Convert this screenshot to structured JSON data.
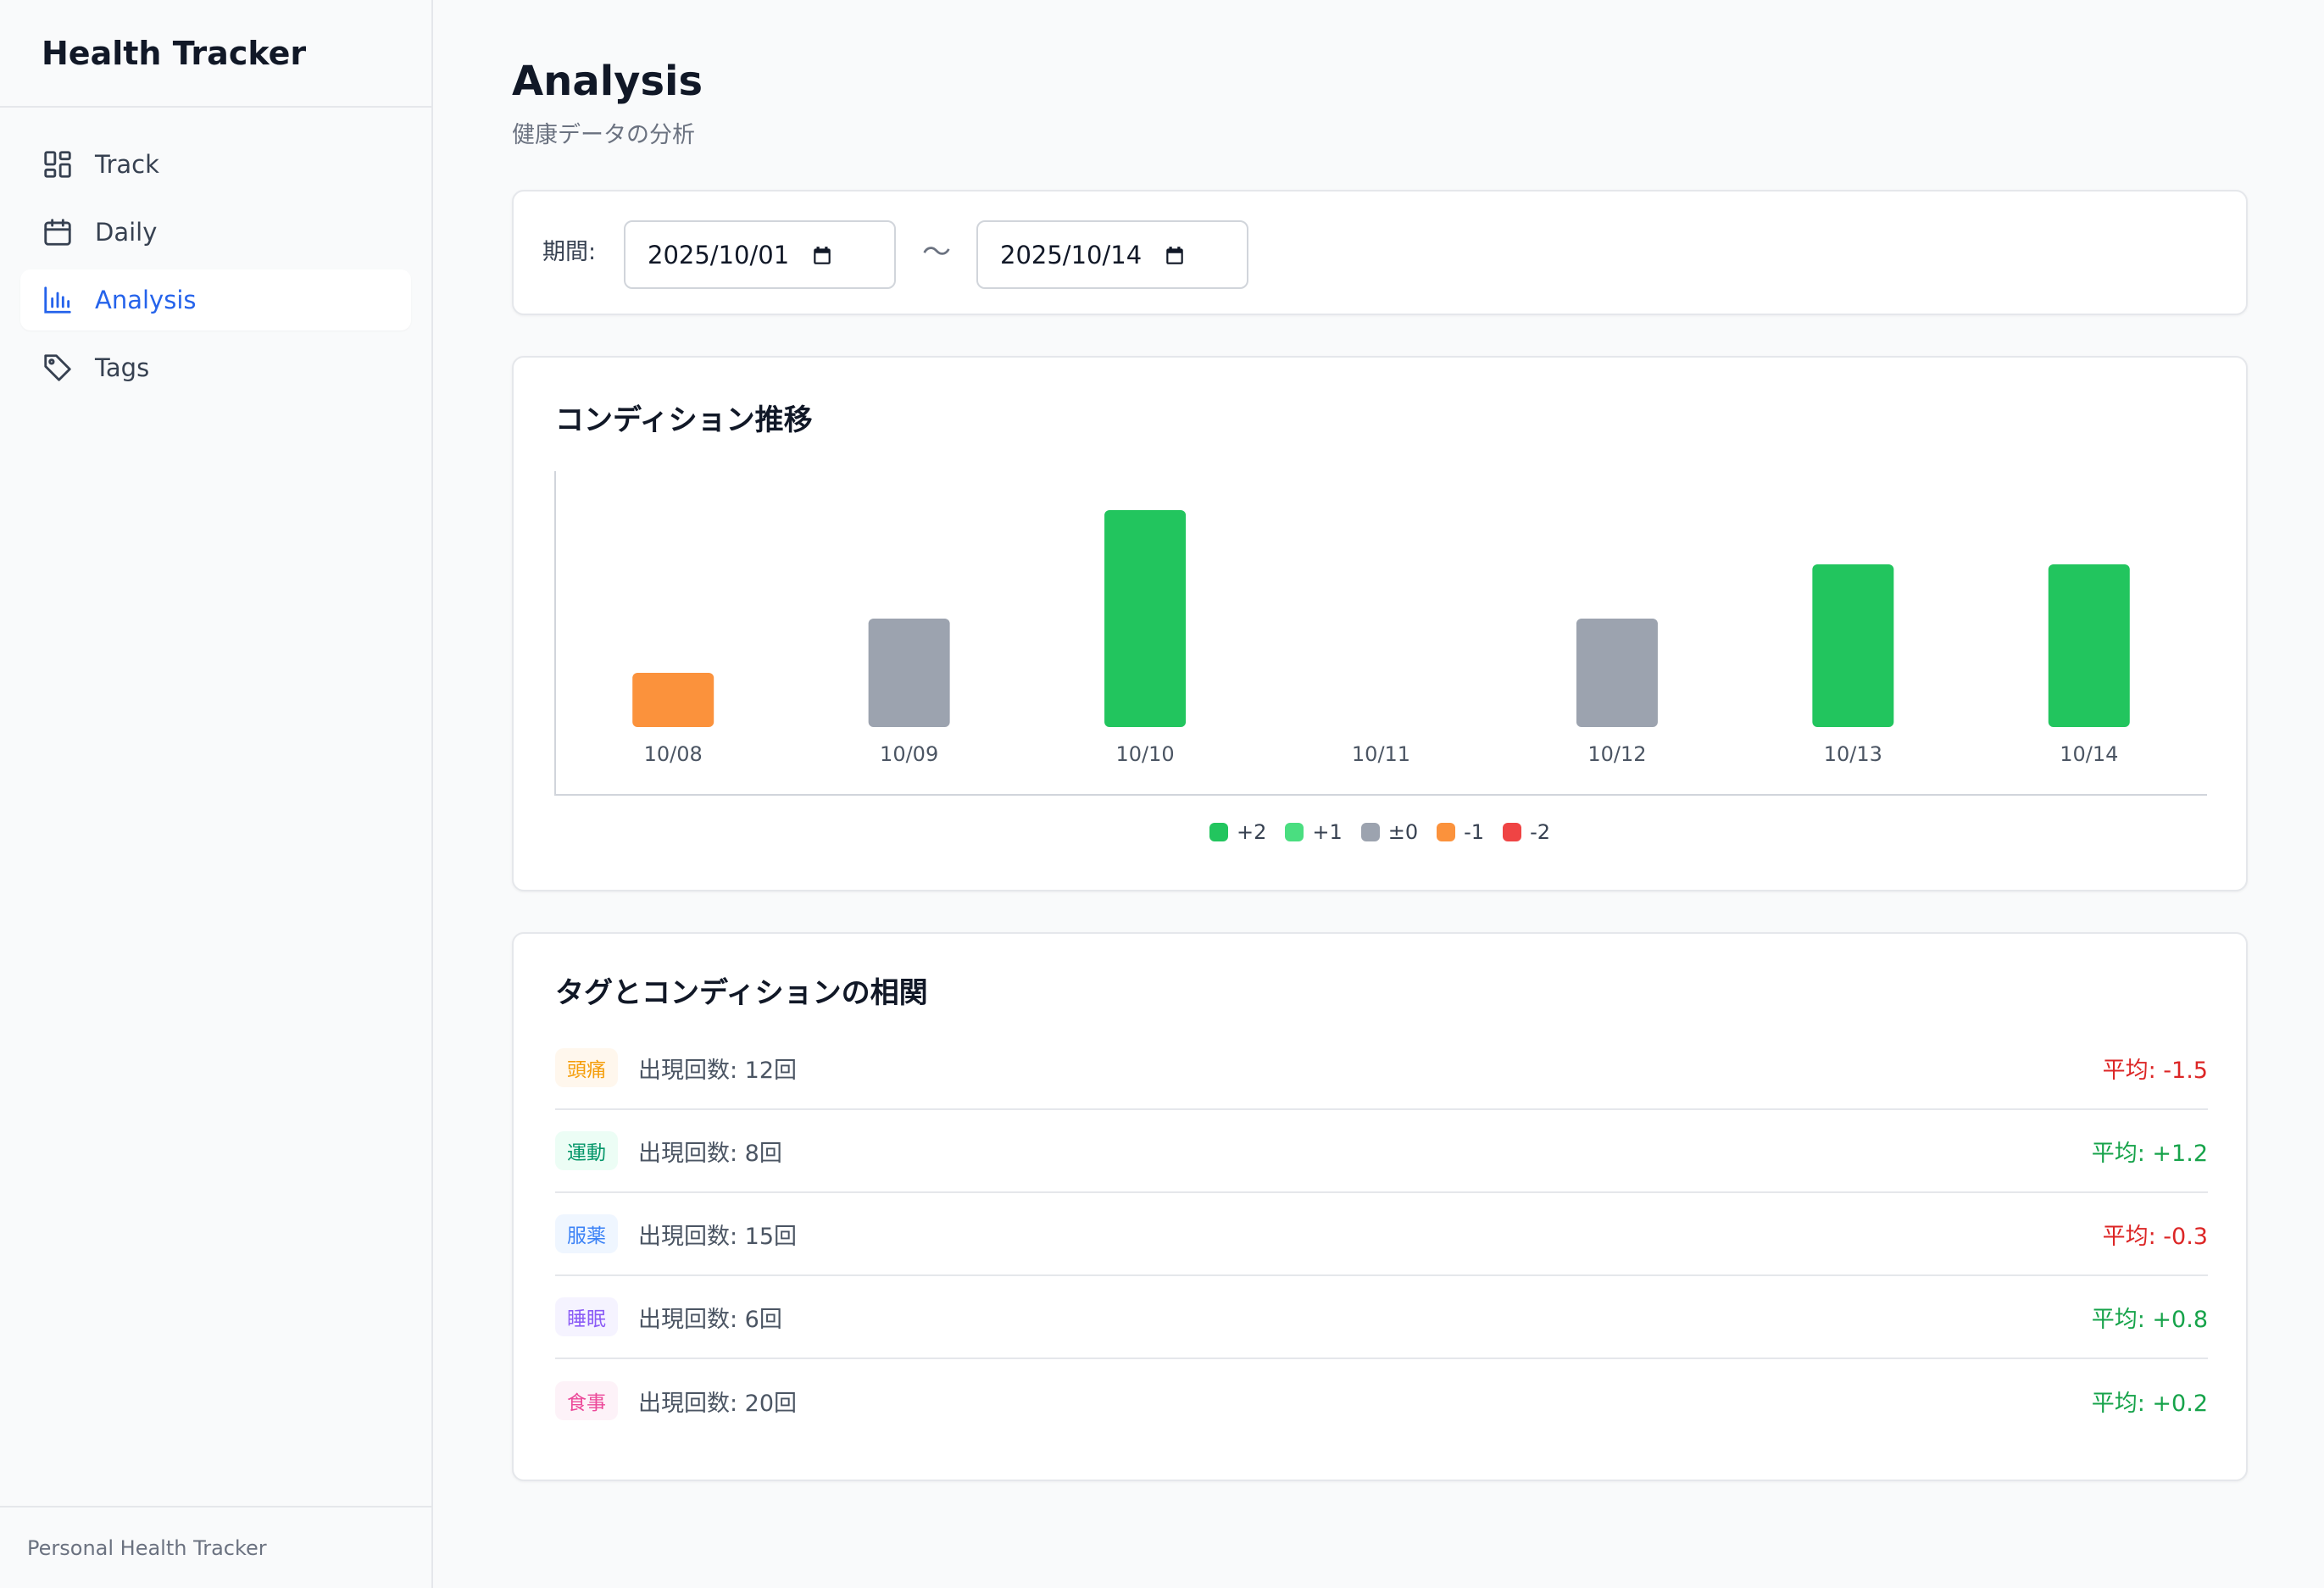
{
  "sidebar": {
    "brand": "Health Tracker",
    "items": [
      {
        "label": "Track",
        "icon": "dashboard-grid-icon",
        "active": false
      },
      {
        "label": "Daily",
        "icon": "calendar-icon",
        "active": false
      },
      {
        "label": "Analysis",
        "icon": "bar-chart-icon",
        "active": true
      },
      {
        "label": "Tags",
        "icon": "tag-icon",
        "active": false
      }
    ],
    "footer": "Personal Health Tracker"
  },
  "header": {
    "title": "Analysis",
    "subtitle": "健康データの分析"
  },
  "period": {
    "label": "期間:",
    "from": "2025/10/01",
    "separator": "〜",
    "to": "2025/10/14"
  },
  "condition_chart": {
    "title": "コンディション推移"
  },
  "chart_data": {
    "type": "bar",
    "title": "コンディション推移",
    "categories": [
      "10/08",
      "10/09",
      "10/10",
      "10/11",
      "10/12",
      "10/13",
      "10/14"
    ],
    "values": [
      -1,
      0,
      2,
      null,
      0,
      1,
      1
    ],
    "bar_colors": [
      "#fb923c",
      "#9ca3af",
      "#22c55e",
      null,
      "#9ca3af",
      "#22c55e",
      "#22c55e"
    ],
    "legend": [
      {
        "label": "+2",
        "color": "#22c55e"
      },
      {
        "label": "+1",
        "color": "#4ade80"
      },
      {
        "label": "±0",
        "color": "#9ca3af"
      },
      {
        "label": "-1",
        "color": "#fb923c"
      },
      {
        "label": "-2",
        "color": "#ef4444"
      }
    ],
    "legend_position": "bottom-center",
    "grid": false
  },
  "correlation": {
    "title": "タグとコンディションの相関",
    "rows": [
      {
        "tag": "頭痛",
        "occurrences": "出現回数: 12回",
        "average": "平均: -1.5",
        "tag_bg": "#fff7ed",
        "tag_color": "#f59e0b",
        "avg_color": "#dc2626"
      },
      {
        "tag": "運動",
        "occurrences": "出現回数: 8回",
        "average": "平均: +1.2",
        "tag_bg": "#ecfdf5",
        "tag_color": "#059669",
        "avg_color": "#16a34a"
      },
      {
        "tag": "服薬",
        "occurrences": "出現回数: 15回",
        "average": "平均: -0.3",
        "tag_bg": "#eff6ff",
        "tag_color": "#3b82f6",
        "avg_color": "#dc2626"
      },
      {
        "tag": "睡眠",
        "occurrences": "出現回数: 6回",
        "average": "平均: +0.8",
        "tag_bg": "#f5f3ff",
        "tag_color": "#8b5cf6",
        "avg_color": "#16a34a"
      },
      {
        "tag": "食事",
        "occurrences": "出現回数: 20回",
        "average": "平均: +0.2",
        "tag_bg": "#fdf2f8",
        "tag_color": "#ec4899",
        "avg_color": "#16a34a"
      }
    ]
  }
}
